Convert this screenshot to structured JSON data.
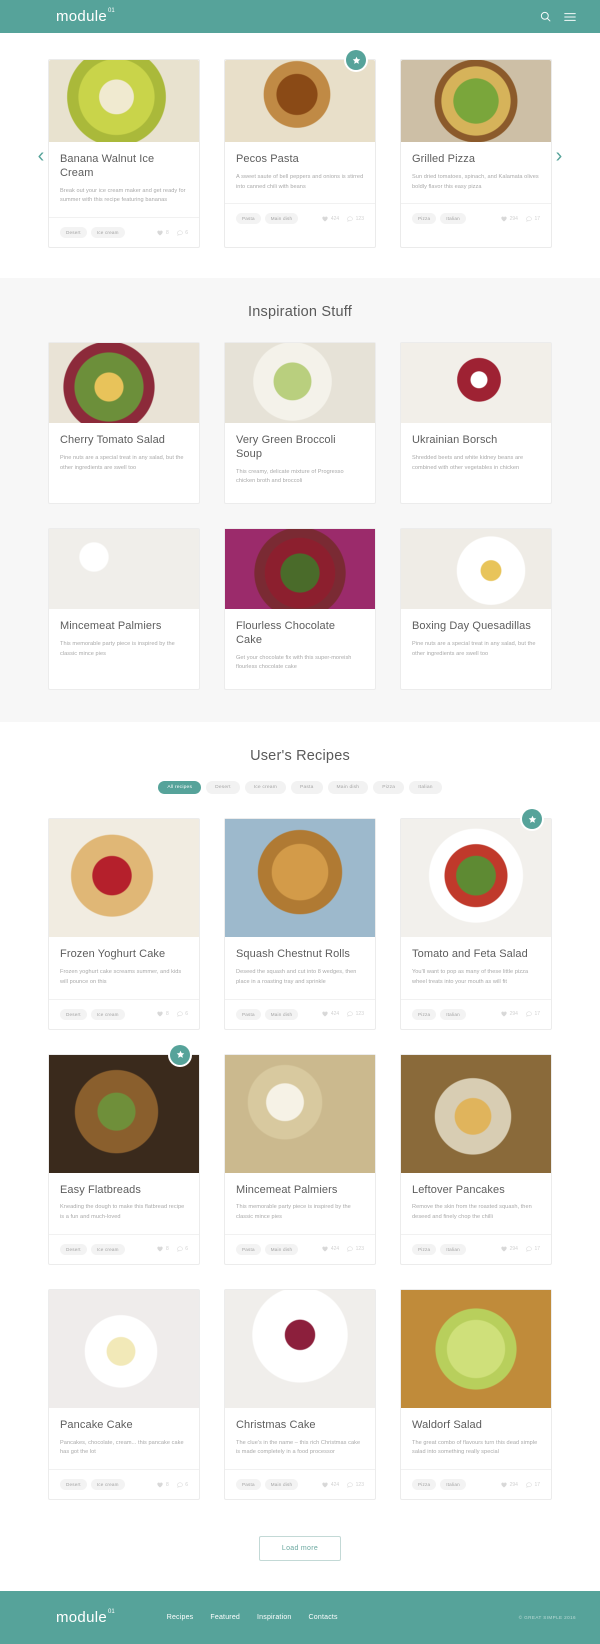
{
  "brand": {
    "name": "module",
    "sup": "01"
  },
  "header": {
    "search_icon": "search-icon",
    "menu_icon": "hamburger-menu-icon"
  },
  "carousel": {
    "prev_label": "‹",
    "next_label": "›",
    "cards": [
      {
        "title": "Banana Walnut Ice Cream",
        "desc": "Break out your ice cream maker and get ready for summer with this recipe featuring bananas",
        "tags": [
          "Desert",
          "Ice cream"
        ],
        "likes": "8",
        "comments": "6",
        "featured": false,
        "image": "bowl-of-banana-ice-cream"
      },
      {
        "title": "Pecos Pasta",
        "desc": "A sweet saute of bell peppers and onions is stirred into canned chili with beans",
        "tags": [
          "Pasta",
          "Main dish"
        ],
        "likes": "424",
        "comments": "123",
        "featured": true,
        "image": "roast-chicken-with-apples"
      },
      {
        "title": "Grilled Pizza",
        "desc": "Sun dried tomatoes, spinach, and Kalamata olives boldly flavor this easy pizza",
        "tags": [
          "Pizza",
          "Italian"
        ],
        "likes": "294",
        "comments": "17",
        "featured": false,
        "image": "grilled-arugula-pizza"
      }
    ]
  },
  "inspiration": {
    "title": "Inspiration Stuff",
    "cards": [
      {
        "title": "Cherry Tomato Salad",
        "desc": "Pine nuts are a special treat in any salad, but the other ingredients are swell too",
        "image": "cherry-tomato-salad"
      },
      {
        "title": "Very Green Broccoli Soup",
        "desc": "This creamy, delicate mixture of Progresso chicken broth and broccoli",
        "image": "green-broccoli-soup"
      },
      {
        "title": "Ukrainian Borsch",
        "desc": "Shredded beets and white kidney beans are combined with other vegetables in chicken",
        "image": "ukrainian-borsch"
      },
      {
        "title": "Mincemeat Palmiers",
        "desc": "This memorable party piece is inspired by the classic mince pies",
        "image": "white-meringues"
      },
      {
        "title": "Flourless Chocolate Cake",
        "desc": "Get your chocolate fix with this super-moreish flourless chocolate cake",
        "image": "berry-topped-cake"
      },
      {
        "title": "Boxing Day Quesadillas",
        "desc": "Pine nuts are a special treat in any salad, but the other ingredients are swell too",
        "image": "plated-breakfast"
      }
    ]
  },
  "recipes": {
    "title": "User's Recipes",
    "filters": [
      {
        "label": "All recipes",
        "active": true
      },
      {
        "label": "Desert",
        "active": false
      },
      {
        "label": "Ice cream",
        "active": false
      },
      {
        "label": "Pasta",
        "active": false
      },
      {
        "label": "Main dish",
        "active": false
      },
      {
        "label": "Pizza",
        "active": false
      },
      {
        "label": "Italian",
        "active": false
      }
    ],
    "load_more": "Load more",
    "cards": [
      {
        "title": "Frozen Yoghurt Cake",
        "desc": "Frozen yoghurt cake screams summer, and kids will pounce on this",
        "tags": [
          "Desert",
          "Ice cream"
        ],
        "likes": "8",
        "comments": "6",
        "featured": false,
        "image": "cherry-pie-slice"
      },
      {
        "title": "Squash Chestnut Rolls",
        "desc": "Deseed the squash and cut into 8 wedges, then place in a roasting tray and sprinkle",
        "tags": [
          "Pasta",
          "Main dish"
        ],
        "likes": "424",
        "comments": "123",
        "featured": false,
        "image": "croissants-on-board"
      },
      {
        "title": "Tomato and Feta Salad",
        "desc": "You'll want to pop as many of these little pizza wheel treats into your mouth as will fit",
        "tags": [
          "Pizza",
          "Italian"
        ],
        "likes": "294",
        "comments": "17",
        "featured": true,
        "image": "tomato-feta-salad-plate"
      },
      {
        "title": "Easy Flatbreads",
        "desc": "Kneading the dough to make this flatbread recipe is a fun and much-loved",
        "tags": [
          "Desert",
          "Ice cream"
        ],
        "likes": "8",
        "comments": "6",
        "featured": true,
        "image": "flatbreads-on-board"
      },
      {
        "title": "Mincemeat Palmiers",
        "desc": "This memorable party piece is inspired by the classic mince pies",
        "tags": [
          "Pasta",
          "Main dish"
        ],
        "likes": "424",
        "comments": "123",
        "featured": false,
        "image": "yoghurt-glasses-apples"
      },
      {
        "title": "Leftover Pancakes",
        "desc": "Remove the skin from the roasted squash, then deseed and finely chop the chilli",
        "tags": [
          "Pizza",
          "Italian"
        ],
        "likes": "294",
        "comments": "17",
        "featured": false,
        "image": "scones-with-honey"
      },
      {
        "title": "Pancake Cake",
        "desc": "Pancakes, chocolate, cream... this pancake cake has got the lot",
        "tags": [
          "Desert",
          "Ice cream"
        ],
        "likes": "8",
        "comments": "6",
        "featured": false,
        "image": "cake-slice-on-floral-plate"
      },
      {
        "title": "Christmas Cake",
        "desc": "The clue's in the name – this rich Christmas cake is made completely in a food processor",
        "tags": [
          "Pasta",
          "Main dish"
        ],
        "likes": "424",
        "comments": "123",
        "featured": false,
        "image": "white-cake-with-berries"
      },
      {
        "title": "Waldorf Salad",
        "desc": "The great combo of flavours turn this dead simple salad into something really special",
        "tags": [
          "Pizza",
          "Italian"
        ],
        "likes": "294",
        "comments": "17",
        "featured": false,
        "image": "bowl-of-pasta-salad"
      }
    ]
  },
  "footer": {
    "links": [
      "Recipes",
      "Featured",
      "Inspiration",
      "Contacts"
    ],
    "copyright": "© GREAT SIMPLE 2016"
  },
  "colors": {
    "brand": "#56a39a",
    "page_bg": "#ffffff",
    "section_bg": "#f7f7f7",
    "title_text": "#5d5d5d",
    "body_text": "#a9a9a9"
  }
}
